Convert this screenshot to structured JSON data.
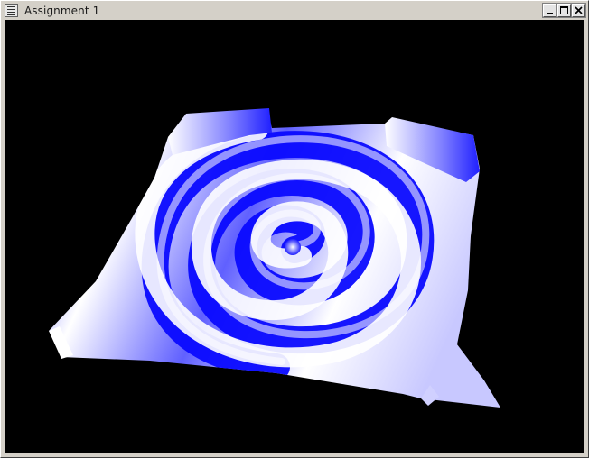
{
  "window": {
    "title": "Assignment 1",
    "controls": [
      "minimize",
      "maximize",
      "close"
    ]
  },
  "viewport": {
    "background": "#000000",
    "surface_colors": [
      "#0000ff",
      "#ffffff"
    ],
    "content": "3d-spiral-surface"
  }
}
